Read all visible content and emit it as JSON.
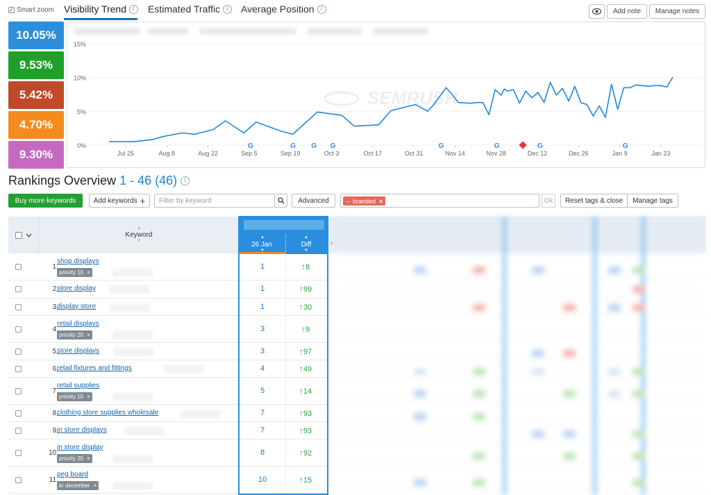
{
  "tabs": {
    "smart_zoom": "Smart zoom",
    "visibility": "Visibility Trend",
    "traffic": "Estimated Traffic",
    "position": "Average Position"
  },
  "top_buttons": {
    "eye": "eye-icon",
    "add_note": "Add note",
    "manage_notes": "Manage notes"
  },
  "cards": [
    {
      "value": "10.05%",
      "color": "#2d8fdc"
    },
    {
      "value": "9.53%",
      "color": "#1fa02a"
    },
    {
      "value": "5.42%",
      "color": "#c0492a"
    },
    {
      "value": "4.70%",
      "color": "#f58b1f"
    },
    {
      "value": "9.30%",
      "color": "#c46bbf"
    }
  ],
  "chart_data": {
    "type": "line",
    "yticks": [
      "15%",
      "10%",
      "5%",
      "0%"
    ],
    "ylim": [
      0,
      15
    ],
    "xticks": [
      "Jul 25",
      "Aug 8",
      "Aug 22",
      "Sep 5",
      "Sep 19",
      "Oct 3",
      "Oct 17",
      "Oct 31",
      "Nov 14",
      "Nov 28",
      "Dec 12",
      "Dec 26",
      "Jan 9",
      "Jan 23"
    ],
    "series": [
      {
        "color": "#1e88d8",
        "x": [
          0,
          4,
          7,
          9,
          12,
          14,
          17,
          19,
          22,
          24,
          28,
          30,
          34,
          38,
          40,
          44,
          46,
          50,
          52,
          53,
          55,
          56,
          57,
          59,
          60,
          61,
          62,
          63,
          64,
          64.5,
          65,
          66,
          67,
          68,
          69,
          70,
          71,
          72,
          73,
          74,
          75,
          76,
          77,
          78,
          79,
          80,
          81,
          82,
          83,
          84,
          85,
          86,
          87,
          88,
          89,
          90,
          91,
          92
        ],
        "y": [
          0.5,
          0.5,
          0.8,
          1.3,
          1.8,
          1.6,
          2.3,
          3.6,
          1.8,
          3.4,
          2.1,
          1.6,
          4.9,
          4.4,
          2.8,
          3.0,
          5.1,
          6.0,
          5.0,
          6.0,
          8.5,
          7.5,
          6.3,
          6.2,
          6.3,
          6.3,
          4.5,
          8.2,
          7.4,
          8.3,
          8.0,
          8.2,
          6.2,
          8.0,
          7.0,
          7.8,
          6.3,
          9.3,
          7.4,
          8.4,
          6.5,
          8.7,
          6.3,
          6.0,
          4.3,
          5.8,
          4.1,
          9.0,
          5.3,
          8.5,
          8.5,
          8.9,
          8.8,
          8.7,
          8.8,
          8.8,
          8.6,
          10.05
        ]
      }
    ],
    "google_markers": [
      "Sep 5",
      "Sep 19",
      "Sep 26",
      "Oct 3",
      "Nov 14",
      "Nov 28",
      "Dec 12",
      "Jan 9"
    ],
    "note_marker": "Dec 5",
    "watermark": "SEMRUSH"
  },
  "rankings": {
    "title": "Rankings Overview",
    "range": "1 - 46 (46)",
    "buy_keywords": "Buy more keywords",
    "add_keywords": "Add keywords",
    "filter_placeholder": "Filter by keyword",
    "advanced": "Advanced",
    "tag_filter": "branded",
    "ok": "Ok",
    "reset_tags": "Reset tags & close",
    "manage_tags": "Manage tags",
    "keyword_header": "Keyword",
    "date_header": "26 Jan",
    "diff_header": "Diff"
  },
  "rows": [
    {
      "n": "1.",
      "kw": "shop displays",
      "tag": "priority 10",
      "pos": "1",
      "diff": "8"
    },
    {
      "n": "2.",
      "kw": "store display",
      "tag": "",
      "pos": "1",
      "diff": "99"
    },
    {
      "n": "3.",
      "kw": "display store",
      "tag": "",
      "pos": "1",
      "diff": "30"
    },
    {
      "n": "4.",
      "kw": "retail displays",
      "tag": "priority 20",
      "pos": "3",
      "diff": "9"
    },
    {
      "n": "5.",
      "kw": "store displays",
      "tag": "",
      "pos": "3",
      "diff": "97"
    },
    {
      "n": "6.",
      "kw": "retail fixtures and fittings",
      "tag": "",
      "pos": "4",
      "diff": "49"
    },
    {
      "n": "7.",
      "kw": "retail supplies",
      "tag": "priority 10",
      "pos": "5",
      "diff": "14"
    },
    {
      "n": "8.",
      "kw": "clothing store supplies wholesale",
      "tag": "",
      "pos": "7",
      "diff": "93"
    },
    {
      "n": "9.",
      "kw": "in store displays",
      "tag": "",
      "pos": "7",
      "diff": "93"
    },
    {
      "n": "10.",
      "kw": "in store display",
      "tag": "priority 20",
      "pos": "8",
      "diff": "92"
    },
    {
      "n": "11.",
      "kw": "peg board",
      "tag": "kr december",
      "pos": "10",
      "diff": "15"
    }
  ]
}
